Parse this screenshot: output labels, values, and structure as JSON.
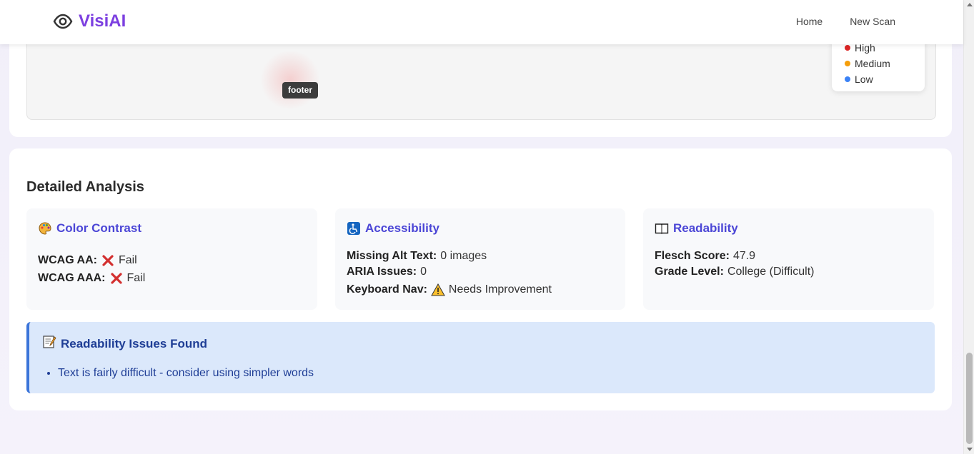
{
  "header": {
    "brand_name": "VisiAI",
    "brand_icon": "eye-icon",
    "nav": {
      "home": "Home",
      "new_scan": "New Scan"
    }
  },
  "heatmap": {
    "tag_label": "footer",
    "legend": [
      {
        "label": "High",
        "color": "#dc2626"
      },
      {
        "label": "Medium",
        "color": "#f59e0b"
      },
      {
        "label": "Low",
        "color": "#3b82f6"
      }
    ]
  },
  "analysis": {
    "title": "Detailed Analysis",
    "color_contrast": {
      "icon": "palette-icon",
      "title": "Color Contrast",
      "aa_label": "WCAG AA:",
      "aa_value": "Fail",
      "aaa_label": "WCAG AAA:",
      "aaa_value": "Fail"
    },
    "accessibility": {
      "icon": "wheelchair-icon",
      "title": "Accessibility",
      "alt_label": "Missing Alt Text:",
      "alt_value": "0 images",
      "aria_label": "ARIA Issues:",
      "aria_value": "0",
      "keyboard_label": "Keyboard Nav:",
      "keyboard_value": "Needs Improvement"
    },
    "readability": {
      "icon": "book-icon",
      "title": "Readability",
      "flesch_label": "Flesch Score:",
      "flesch_value": "47.9",
      "grade_label": "Grade Level:",
      "grade_value": "College (Difficult)"
    },
    "issues": {
      "icon": "memo-icon",
      "title": "Readability Issues Found",
      "items": [
        "Text is fairly difficult - consider using simpler words"
      ]
    }
  }
}
